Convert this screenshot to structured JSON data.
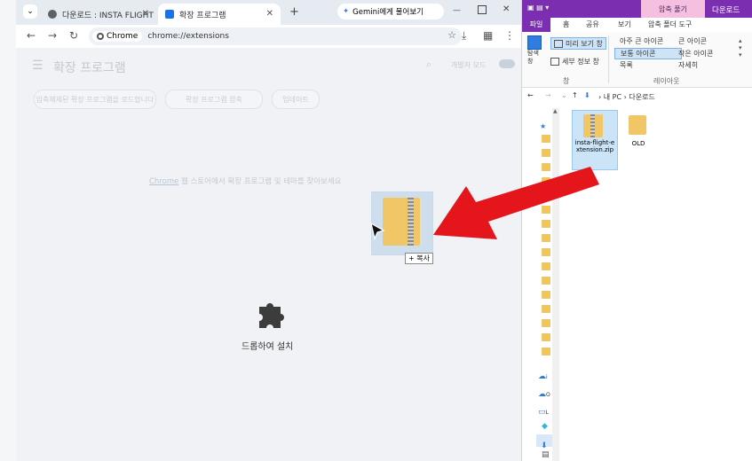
{
  "chrome": {
    "tabs": [
      {
        "label": "다운로드 : INSTA FLIGHT"
      },
      {
        "label": "확장 프로그램"
      }
    ],
    "gemini_label": "Gemini에게 물어보기",
    "omnibox": {
      "chip": "Chrome",
      "url": "chrome://extensions"
    },
    "page": {
      "title": "확장 프로그램",
      "search_icon": "search-icon",
      "devmode_label": "개발자 모드",
      "buttons": [
        "압축해제된 확장 프로그램을 로드합니다",
        "확장 프로그램 압축",
        "업데이트"
      ],
      "store_link": "Chrome",
      "store_text": "웹 스토어에서 확장 프로그램 및 테마를 찾아보세요",
      "drop_text": "드롭하여 설치"
    },
    "drag": {
      "copy_badge": "+ 복사"
    }
  },
  "explorer": {
    "title_tab": "압축 풀기",
    "title_text": "다운로드",
    "ribbon_tabs": [
      "파일",
      "홈",
      "공유",
      "보기",
      "압축 폴더 도구"
    ],
    "ribbon": {
      "pane_label": "탐색 창",
      "preview_pane": "미리 보기 창",
      "details_pane": "세부 정보 창",
      "group_pane": "창",
      "layout_items": [
        "아주 큰 아이콘",
        "큰 아이콘",
        "보통 아이콘",
        "작은 아이콘",
        "목록",
        "자세히"
      ],
      "group_layout": "레이아웃"
    },
    "breadcrumb": [
      "내 PC",
      "다운로드"
    ],
    "files": [
      {
        "name": "insta-flight-extension.zip"
      },
      {
        "name": "OLD"
      }
    ],
    "nav_labels": [
      "i",
      "O",
      "L"
    ]
  },
  "colors": {
    "accent": "#7b2fb0",
    "arrow": "#e5151c"
  }
}
